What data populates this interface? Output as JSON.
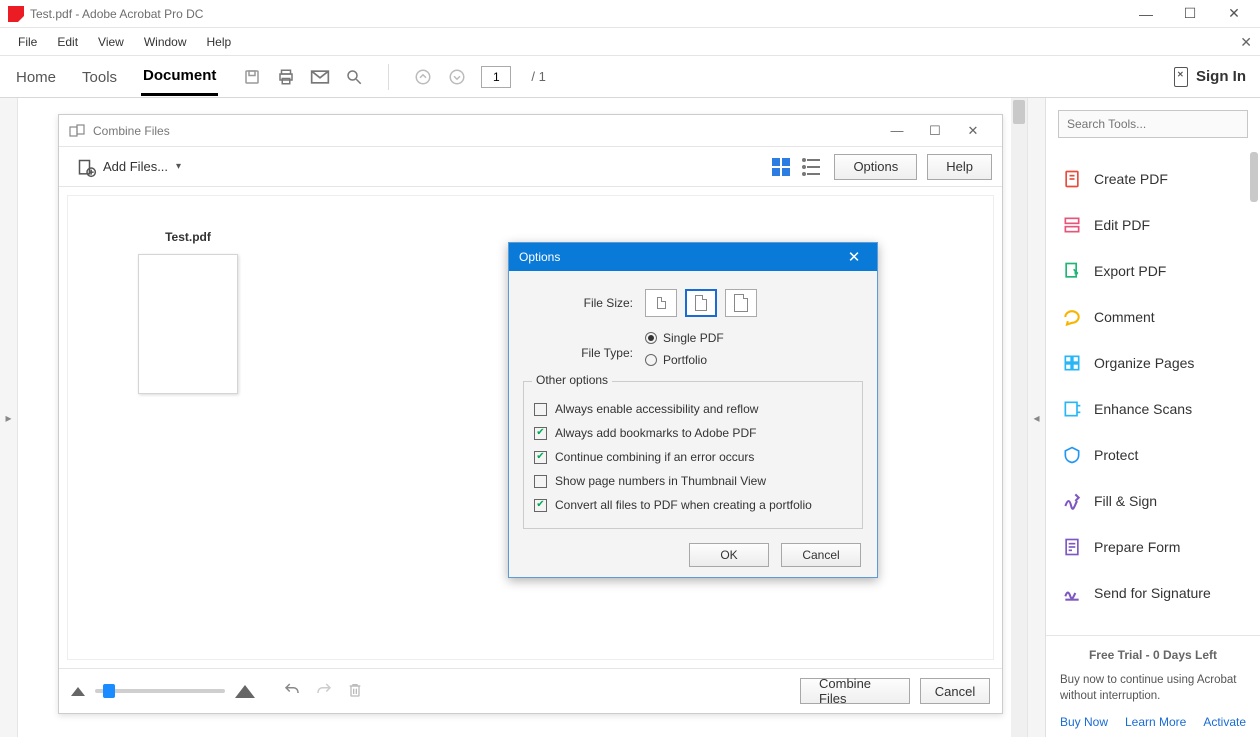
{
  "window": {
    "title": "Test.pdf - Adobe Acrobat Pro DC"
  },
  "menu": {
    "items": [
      "File",
      "Edit",
      "View",
      "Window",
      "Help"
    ]
  },
  "toolbar": {
    "tabs": {
      "home": "Home",
      "tools": "Tools",
      "document": "Document"
    },
    "page_current": "1",
    "page_total": "/  1",
    "signin": "Sign In"
  },
  "right_panel": {
    "search_placeholder": "Search Tools...",
    "tools": [
      "Create PDF",
      "Edit PDF",
      "Export PDF",
      "Comment",
      "Organize Pages",
      "Enhance Scans",
      "Protect",
      "Fill & Sign",
      "Prepare Form",
      "Send for Signature"
    ],
    "colors": [
      "#e74c3c",
      "#e6567a",
      "#21b573",
      "#f7b500",
      "#29b6f6",
      "#29b6f6",
      "#2196f3",
      "#7e57c2",
      "#7e57c2",
      "#7e57c2"
    ],
    "trial_title": "Free Trial - 0 Days Left",
    "trial_desc": "Buy now to continue using Acrobat without interruption.",
    "buy": "Buy Now",
    "learn": "Learn More",
    "activate": "Activate"
  },
  "combine": {
    "title": "Combine Files",
    "add_files": "Add Files...",
    "options_btn": "Options",
    "help_btn": "Help",
    "thumb_name": "Test.pdf",
    "combine_btn": "Combine Files",
    "cancel_btn": "Cancel"
  },
  "options_dialog": {
    "title": "Options",
    "file_size_label": "File Size:",
    "file_type_label": "File Type:",
    "single_pdf": "Single PDF",
    "portfolio": "Portfolio",
    "other_legend": "Other options",
    "opts": [
      {
        "label": "Always enable accessibility and reflow",
        "checked": false
      },
      {
        "label": "Always add bookmarks to Adobe PDF",
        "checked": true
      },
      {
        "label": "Continue combining if an error occurs",
        "checked": true
      },
      {
        "label": "Show page numbers in Thumbnail View",
        "checked": false
      },
      {
        "label": "Convert all files to PDF when creating a portfolio",
        "checked": true
      }
    ],
    "ok": "OK",
    "cancel": "Cancel"
  }
}
